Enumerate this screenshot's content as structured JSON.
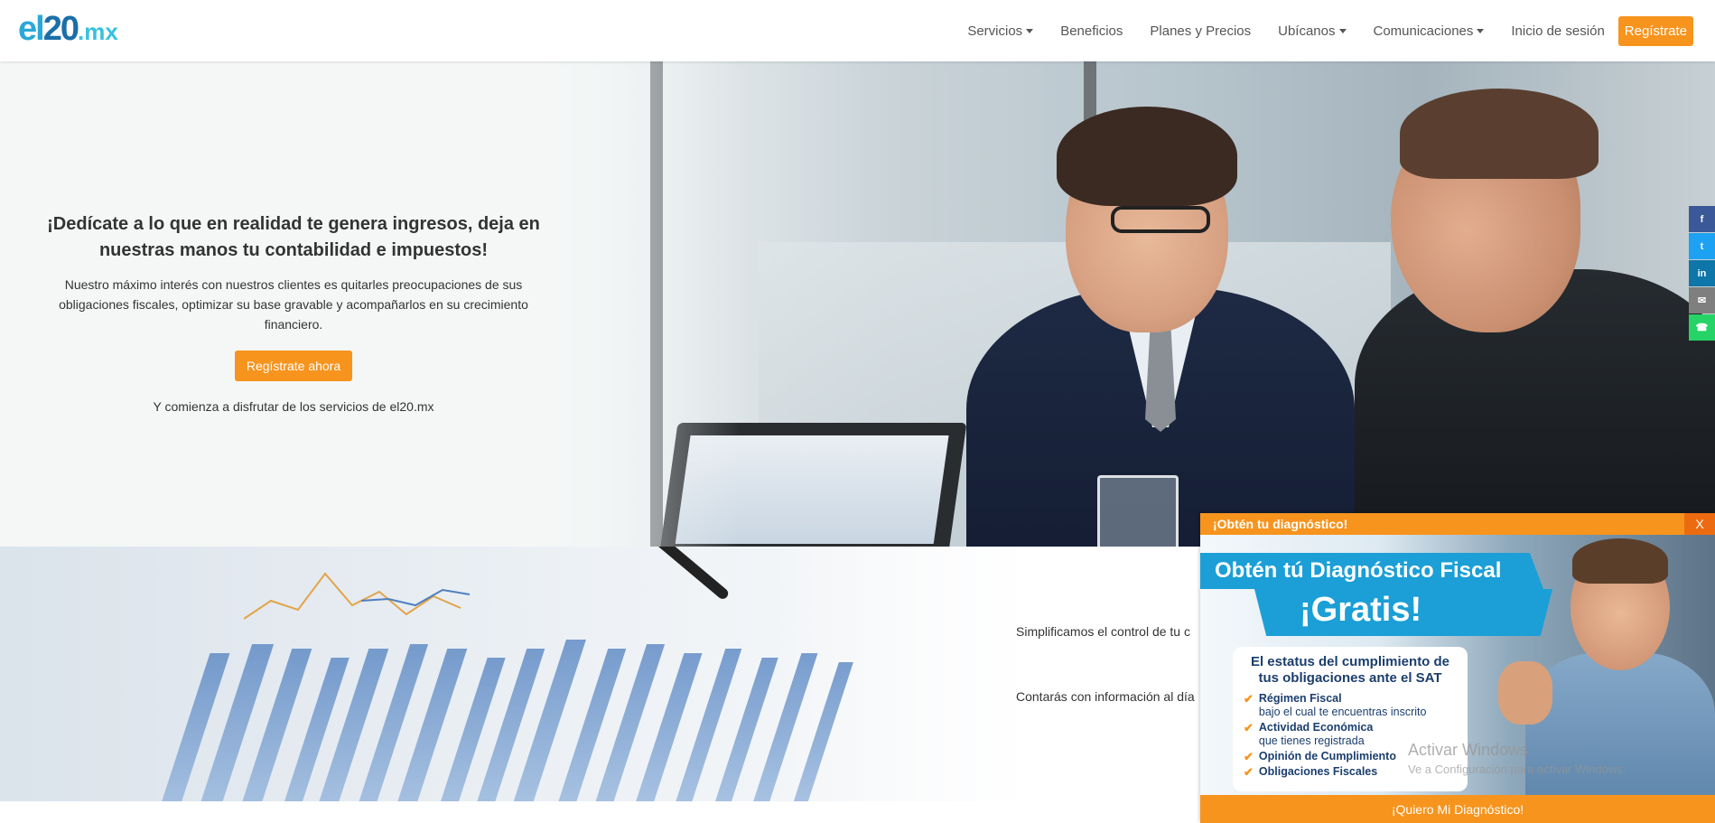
{
  "brand": {
    "logo_el": "el",
    "logo_20": "20",
    "logo_mx": ".mx",
    "accent": "#f7941d",
    "logo_color": "#2aa8d8"
  },
  "nav": {
    "items": [
      {
        "label": "Servicios",
        "dropdown": true
      },
      {
        "label": "Beneficios",
        "dropdown": false
      },
      {
        "label": "Planes y Precios",
        "dropdown": false
      },
      {
        "label": "Ubícanos",
        "dropdown": true
      },
      {
        "label": "Comunicaciones",
        "dropdown": true
      },
      {
        "label": "Inicio de sesión",
        "dropdown": false
      }
    ],
    "register": "Regístrate"
  },
  "hero": {
    "title": "¡Dedícate a lo que en realidad te genera ingresos, deja en nuestras manos tu contabilidad e impuestos!",
    "description": "Nuestro máximo interés con nuestros clientes es quitarles preocupaciones de sus obligaciones fiscales, optimizar su base gravable y acompañarlos en su crecimiento financiero.",
    "button": "Regístrate ahora",
    "subtext": "Y comienza a disfrutar de los servicios de el20.mx"
  },
  "section2": {
    "line1": "Simplificamos el control de tu c",
    "line2": "Contarás con información al día"
  },
  "social": [
    {
      "icon": "facebook-icon",
      "glyph": "f",
      "color": "#3b5998"
    },
    {
      "icon": "twitter-icon",
      "glyph": "t",
      "color": "#1da1f2"
    },
    {
      "icon": "linkedin-icon",
      "glyph": "in",
      "color": "#0e76a8"
    },
    {
      "icon": "email-icon",
      "glyph": "✉",
      "color": "#7f7f7f"
    },
    {
      "icon": "whatsapp-icon",
      "glyph": "☎",
      "color": "#25d366"
    }
  ],
  "popup": {
    "title": "¡Obtén tu diagnóstico!",
    "close": "X",
    "promo_line1": "Obtén tú Diagnóstico Fiscal",
    "promo_line2": "¡Gratis!",
    "card_title": "El estatus del cumplimiento de tus obligaciones ante el SAT",
    "items": [
      {
        "strong": "Régimen Fiscal",
        "sub": "bajo el cual te encuentras inscrito"
      },
      {
        "strong": "Actividad Económica",
        "sub": "que tienes registrada"
      },
      {
        "strong": "Opinión de Cumplimiento",
        "sub": ""
      },
      {
        "strong": "Obligaciones Fiscales",
        "sub": ""
      }
    ],
    "watermark": "Activar Windows",
    "watermark_sub": "Ve a Configuración para activar Windows.",
    "cta": "¡Quiero Mi Diagnóstico!"
  }
}
